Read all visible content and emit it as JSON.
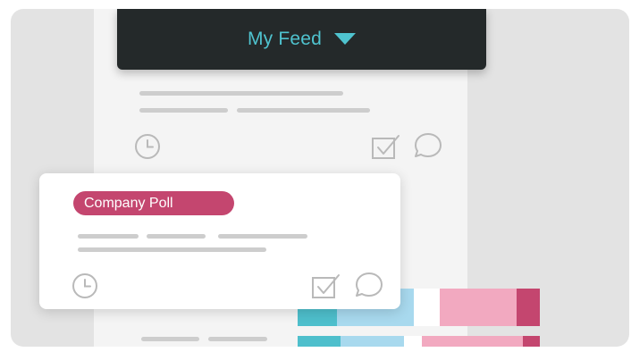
{
  "header": {
    "title": "My Feed",
    "dropdown_icon": "caret-down-icon",
    "title_color": "#4fc3cf",
    "background": "#24292a"
  },
  "feed_post": {
    "icons": [
      "clock-icon",
      "checkbox-icon",
      "comment-icon"
    ]
  },
  "poll_card": {
    "badge_label": "Company Poll",
    "badge_color": "#c4466f",
    "icons": [
      "clock-icon",
      "checkbox-icon",
      "comment-icon"
    ]
  },
  "poll_results": {
    "segment_colors": [
      "#4ebfcc",
      "#a8d9ee",
      "#ffffff",
      "#f2a9c0",
      "#c4466f"
    ]
  }
}
